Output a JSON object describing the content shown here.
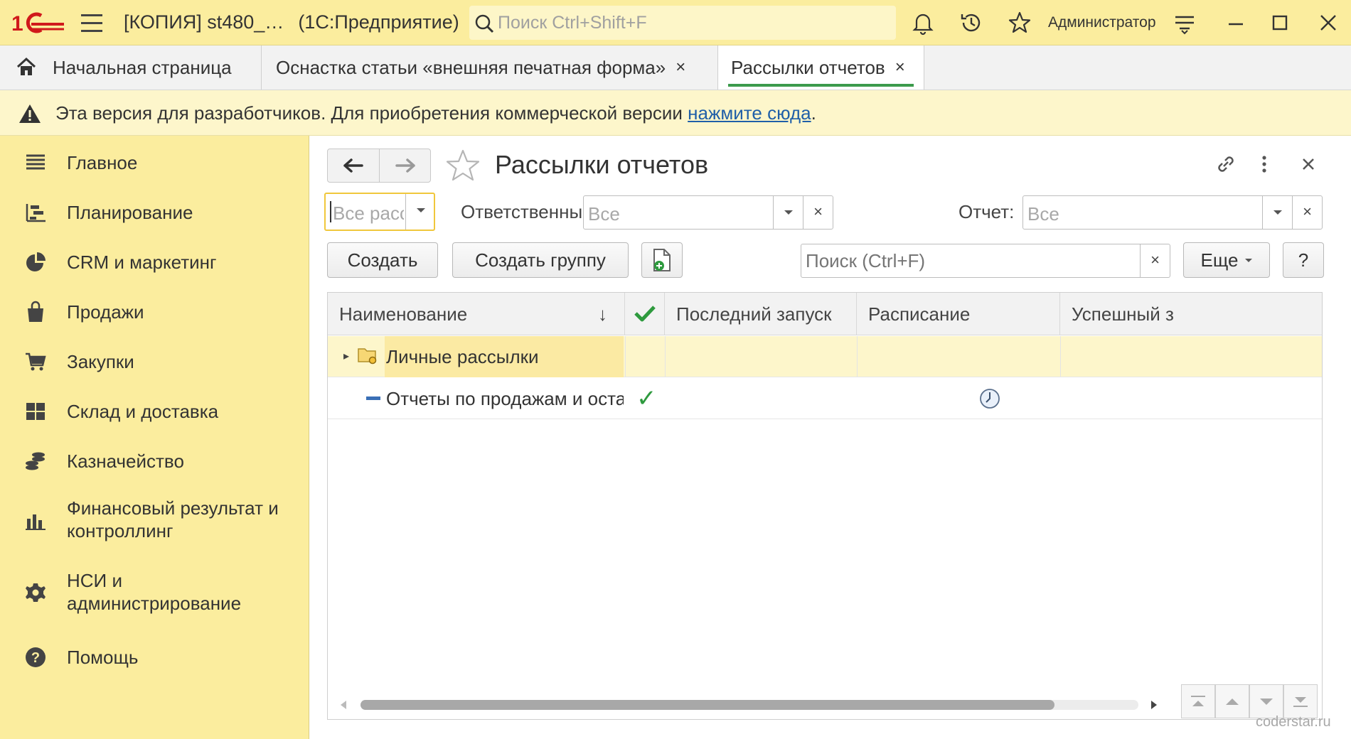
{
  "app": {
    "title": "[КОПИЯ] st480_…",
    "title_suffix": "(1С:Предприятие)",
    "search_placeholder": "Поиск Ctrl+Shift+F",
    "user": "Администратор"
  },
  "tabs": [
    {
      "label": "Начальная страница"
    },
    {
      "label": "Оснастка статьи «внешняя печатная форма»",
      "close": "×"
    },
    {
      "label": "Рассылки отчетов",
      "close": "×"
    }
  ],
  "banner": {
    "text": "Эта версия для разработчиков. Для приобретения коммерческой версии ",
    "link": "нажмите сюда",
    "end": "."
  },
  "sidebar": {
    "items": [
      {
        "label": "Главное",
        "icon": "menu-list-icon"
      },
      {
        "label": "Планирование",
        "icon": "planning-icon"
      },
      {
        "label": "CRM и маркетинг",
        "icon": "pie-chart-icon"
      },
      {
        "label": "Продажи",
        "icon": "shopping-bag-icon"
      },
      {
        "label": "Закупки",
        "icon": "cart-icon"
      },
      {
        "label": "Склад и доставка",
        "icon": "warehouse-icon"
      },
      {
        "label": "Казначейство",
        "icon": "coins-icon"
      },
      {
        "label": "Финансовый результат и",
        "label2": "контроллинг",
        "icon": "bar-chart-icon"
      },
      {
        "label": "НСИ и",
        "label2": "администрирование",
        "icon": "gear-icon"
      },
      {
        "label": "Помощь",
        "icon": "help-icon"
      }
    ]
  },
  "form": {
    "title": "Рассылки отчетов",
    "filters": {
      "kind_value": "Все рассы…",
      "responsible_label": "Ответственный:",
      "responsible_value": "Все",
      "report_label": "Отчет:",
      "report_value": "Все",
      "clear": "×"
    },
    "buttons": {
      "create": "Создать",
      "create_group": "Создать группу",
      "search_placeholder": "Поиск (Ctrl+F)",
      "search_clear": "×",
      "more": "Еще",
      "help": "?"
    },
    "table": {
      "columns": [
        "Наименование",
        "Последний запуск",
        "Расписание",
        "Успешный з"
      ],
      "sort_arrow": "↓",
      "rows": [
        {
          "name": "Личные рассылки",
          "type": "folder",
          "expander": "▸"
        },
        {
          "name": "Отчеты по продажам и оста…",
          "type": "item",
          "enabled": "✓"
        }
      ]
    }
  },
  "watermark": "coderstar.ru",
  "colors": {
    "accent_yellow": "#fbed9e",
    "tab_underline": "#3c9a4c",
    "check_green": "#2e9a3e",
    "link_blue": "#1f5fa8"
  }
}
